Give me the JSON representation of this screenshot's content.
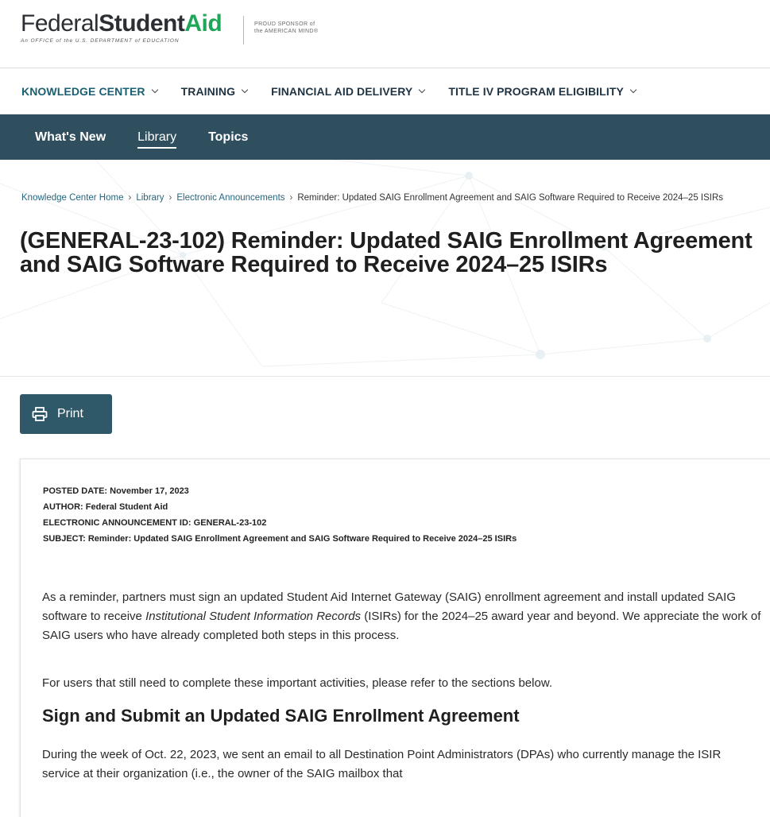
{
  "header": {
    "logo_federal": "Federal",
    "logo_student": "Student",
    "logo_aid": "Aid",
    "logo_sub": "An OFFICE of the U.S. DEPARTMENT of EDUCATION",
    "sponsor_line1": "PROUD SPONSOR of",
    "sponsor_line2": "the AMERICAN MIND®",
    "brand_green": "#1fa65a"
  },
  "primary_nav": [
    {
      "label": "KNOWLEDGE CENTER"
    },
    {
      "label": "TRAINING"
    },
    {
      "label": "FINANCIAL AID DELIVERY"
    },
    {
      "label": "TITLE IV PROGRAM ELIGIBILITY"
    }
  ],
  "secondary_nav": {
    "bg_color": "#2f4f5f",
    "items": [
      {
        "label": "What's New"
      },
      {
        "label": "Library",
        "active": true
      },
      {
        "label": "Topics"
      }
    ]
  },
  "breadcrumb": [
    {
      "label": "Knowledge Center Home"
    },
    {
      "label": "Library"
    },
    {
      "label": "Electronic Announcements"
    },
    {
      "label": "Reminder: Updated SAIG Enrollment Agreement and SAIG Software Required to Receive 2024–25 ISIRs"
    }
  ],
  "page_title": "(GENERAL-23-102) Reminder: Updated SAIG Enrollment Agreement and SAIG Software Required to Receive 2024–25 ISIRs",
  "print_button": {
    "label": "Print",
    "icon": "printer-icon"
  },
  "meta": {
    "posted_date": "POSTED DATE: November 17, 2023",
    "author": "AUTHOR: Federal Student Aid",
    "announcement_id": "ELECTRONIC ANNOUNCEMENT ID: GENERAL-23-102",
    "subject": "SUBJECT: Reminder: Updated SAIG Enrollment Agreement and SAIG Software Required to Receive 2024–25 ISIRs"
  },
  "body": {
    "p1_part1": "As a reminder, partners must sign an updated Student Aid Internet Gateway (SAIG) enrollment agreement and install updated SAIG software to receive ",
    "p1_italic": "Institutional Student Information Records",
    "p1_part2": " (ISIRs) for the 2024–25 award year and beyond. We appreciate the work of SAIG users who have already completed both steps in this process.",
    "p2": "For users that still need to complete these important activities, please refer to the sections below.",
    "section_heading": "Sign and Submit an Updated SAIG Enrollment Agreement",
    "p3": "During the week of Oct. 22, 2023, we sent an email to all Destination Point Administrators (DPAs) who currently manage the ISIR service at their organization (i.e., the owner of the SAIG mailbox that"
  }
}
